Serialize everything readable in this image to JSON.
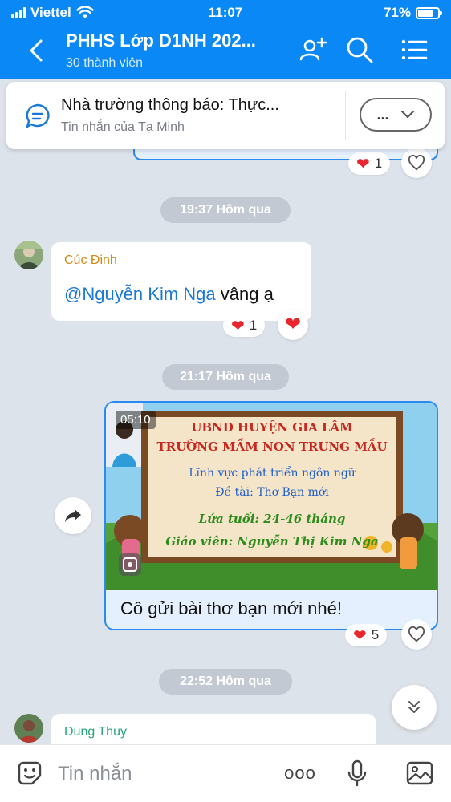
{
  "status": {
    "carrier": "Viettel",
    "time": "11:07",
    "battery": "71%"
  },
  "header": {
    "title": "PHHS Lớp D1NH 202...",
    "subtitle": "30 thành viên",
    "icons": [
      "back-icon",
      "add-member-icon",
      "search-icon",
      "menu-list-icon"
    ]
  },
  "pinned": {
    "title": "Nhà trường thông báo: Thực...",
    "subtitle": "Tin nhắn của Tạ Minh",
    "more_label": "..."
  },
  "top_reaction": {
    "count": "1"
  },
  "messages": [
    {
      "time": "19:37 Hôm qua",
      "sender": "Cúc Đinh",
      "mention": "@Nguyễn Kim Nga",
      "text": " vâng ạ",
      "reaction_count": "1"
    },
    {
      "time": "21:17 Hôm qua",
      "video_duration": "05:10",
      "thumbnail_lines": [
        "UBND HUYỆN GIA LÂM",
        "TRƯỜNG MẦM NON TRUNG MẦU",
        "Lĩnh vực phát triển ngôn ngữ",
        "Đề tài: Thơ Bạn mới",
        "Lứa tuổi: 24-46 tháng",
        "Giáo viên: Nguyễn Thị Kim Nga"
      ],
      "caption": "Cô gửi bài thơ bạn mới nhé!",
      "reaction_count": "5"
    },
    {
      "time": "22:52 Hôm qua",
      "sender": "Dung Thuy"
    }
  ],
  "composer": {
    "placeholder": "Tin nhắn",
    "more_label": "ooo"
  },
  "colors": {
    "accent": "#0a88f5",
    "mention": "#1a78d6",
    "heart": "#e8262f",
    "sender1": "#d08a15",
    "sender2": "#2aa67a"
  }
}
